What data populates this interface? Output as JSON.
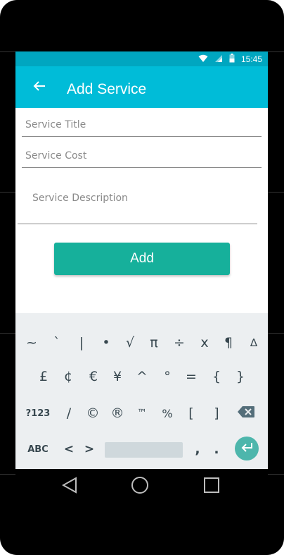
{
  "status_bar": {
    "time": "15:45",
    "icons": [
      "wifi-icon",
      "signal-icon",
      "battery-icon"
    ]
  },
  "app_bar": {
    "title": "Add Service",
    "back_icon": "arrow-back-icon"
  },
  "form": {
    "service_title_placeholder": "Service Title",
    "service_cost_placeholder": "Service Cost",
    "service_description_placeholder": "Service Description",
    "add_label": "Add"
  },
  "keyboard": {
    "row1": [
      "~",
      "`",
      "|",
      "•",
      "√",
      "π",
      "÷",
      "x",
      "¶",
      "∆"
    ],
    "row2": [
      "£",
      "¢",
      "€",
      "¥",
      "^",
      "°",
      "=",
      "{",
      "}"
    ],
    "row3": [
      "?123",
      "/",
      "©",
      "®",
      "™",
      "%",
      "[",
      "]"
    ],
    "row3_backspace_icon": "backspace-icon",
    "row4": [
      "ABC",
      "<",
      ">",
      ",",
      "."
    ],
    "enter_icon": "enter-icon"
  },
  "nav_bar": {
    "back_icon": "nav-back-icon",
    "home_icon": "nav-home-icon",
    "recents_icon": "nav-recents-icon"
  },
  "colors": {
    "status_bar": "#00a6c0",
    "app_bar": "#00bcd8",
    "button": "#16b09b",
    "keyboard": "#eceff1",
    "enter": "#4db6ac"
  }
}
